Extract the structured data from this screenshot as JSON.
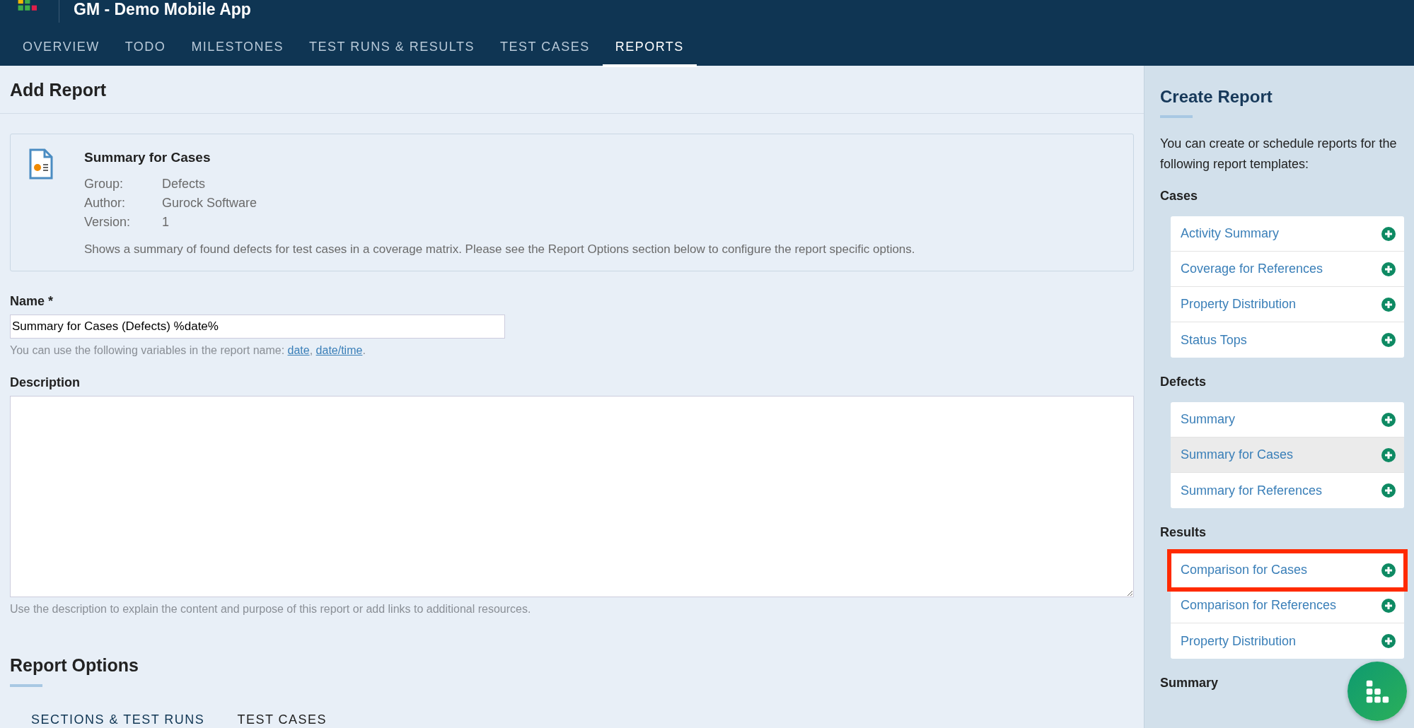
{
  "header": {
    "title": "GM - Demo Mobile App"
  },
  "tabs": [
    {
      "label": "OVERVIEW",
      "selected": false
    },
    {
      "label": "TODO",
      "selected": false
    },
    {
      "label": "MILESTONES",
      "selected": false
    },
    {
      "label": "TEST RUNS & RESULTS",
      "selected": false
    },
    {
      "label": "TEST CASES",
      "selected": false
    },
    {
      "label": "REPORTS",
      "selected": true
    }
  ],
  "page_title": "Add Report",
  "template": {
    "title": "Summary for Cases",
    "fields": [
      {
        "label": "Group:",
        "value": "Defects"
      },
      {
        "label": "Author:",
        "value": "Gurock Software"
      },
      {
        "label": "Version:",
        "value": "1"
      }
    ],
    "description": "Shows a summary of found defects for test cases in a coverage matrix. Please see the Report Options section below to configure the report specific options."
  },
  "name_field": {
    "label": "Name *",
    "value": "Summary for Cases (Defects) %date%",
    "hint": "You can use the following variables in the report name: ",
    "links": [
      "date",
      "date/time"
    ],
    "separator": ", ",
    "end": "."
  },
  "description_field": {
    "label": "Description",
    "hint": "Use the description to explain the content and purpose of this report or add links to additional resources."
  },
  "report_options": {
    "title": "Report Options",
    "tabs": [
      {
        "label": "SECTIONS & TEST RUNS",
        "selected": true
      },
      {
        "label": "TEST CASES",
        "selected": false
      }
    ]
  },
  "sidebar": {
    "title": "Create Report",
    "intro": "You can create or schedule reports for the following report templates:",
    "groups": [
      {
        "name": "Cases",
        "items": [
          {
            "label": "Activity Summary",
            "selected": false,
            "highlighted": false
          },
          {
            "label": "Coverage for References",
            "selected": false,
            "highlighted": false
          },
          {
            "label": "Property Distribution",
            "selected": false,
            "highlighted": false
          },
          {
            "label": "Status Tops",
            "selected": false,
            "highlighted": false
          }
        ]
      },
      {
        "name": "Defects",
        "items": [
          {
            "label": "Summary",
            "selected": false,
            "highlighted": false
          },
          {
            "label": "Summary for Cases",
            "selected": true,
            "highlighted": false
          },
          {
            "label": "Summary for References",
            "selected": false,
            "highlighted": false
          }
        ]
      },
      {
        "name": "Results",
        "items": [
          {
            "label": "Comparison for Cases",
            "selected": false,
            "highlighted": true
          },
          {
            "label": "Comparison for References",
            "selected": false,
            "highlighted": false
          },
          {
            "label": "Property Distribution",
            "selected": false,
            "highlighted": false
          }
        ]
      },
      {
        "name": "Summary"
      }
    ]
  }
}
